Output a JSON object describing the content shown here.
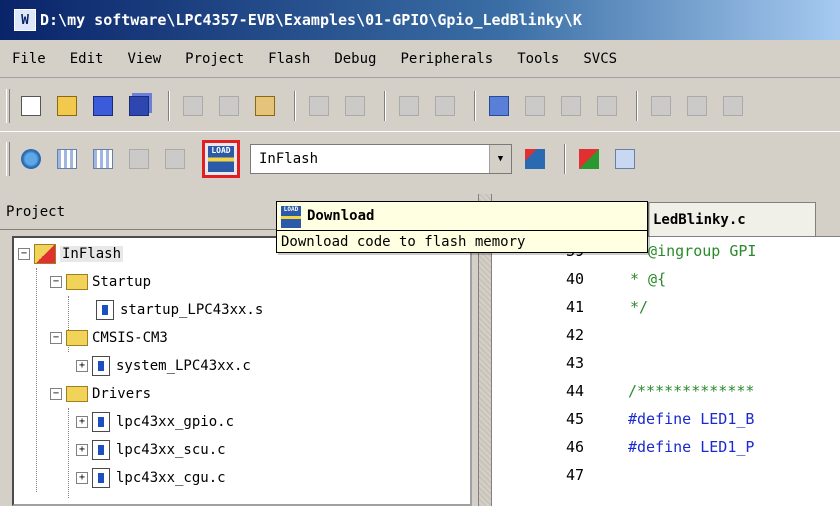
{
  "window": {
    "title": "D:\\my software\\LPC4357-EVB\\Examples\\01-GPIO\\Gpio_LedBlinky\\K"
  },
  "menu": [
    "File",
    "Edit",
    "View",
    "Project",
    "Flash",
    "Debug",
    "Peripherals",
    "Tools",
    "SVCS"
  ],
  "toolbar": {
    "target_value": "InFlash",
    "load_label": "LOAD"
  },
  "tooltip": {
    "title": "Download",
    "description": "Download code to flash memory"
  },
  "project_panel": {
    "title": "Project",
    "tree": {
      "target": "InFlash",
      "groups": [
        {
          "name": "Startup",
          "files": [
            "startup_LPC43xx.s"
          ]
        },
        {
          "name": "CMSIS-CM3",
          "files": [
            "system_LPC43xx.c"
          ]
        },
        {
          "name": "Drivers",
          "files": [
            "lpc43xx_gpio.c",
            "lpc43xx_scu.c",
            "lpc43xx_cgu.c"
          ]
        }
      ]
    }
  },
  "editor": {
    "tab_label": "LedBlinky.c",
    "lines": [
      {
        "num": "39",
        "text": "* @ingroup GPI"
      },
      {
        "num": "40",
        "text": "* @{"
      },
      {
        "num": "41",
        "text": "*/"
      },
      {
        "num": "42",
        "text": ""
      },
      {
        "num": "43",
        "text": ""
      },
      {
        "num": "44",
        "text": "/*************"
      },
      {
        "num": "45",
        "text": "#define LED1_B"
      },
      {
        "num": "46",
        "text": "#define LED1_P"
      },
      {
        "num": "47",
        "text": ""
      }
    ]
  }
}
